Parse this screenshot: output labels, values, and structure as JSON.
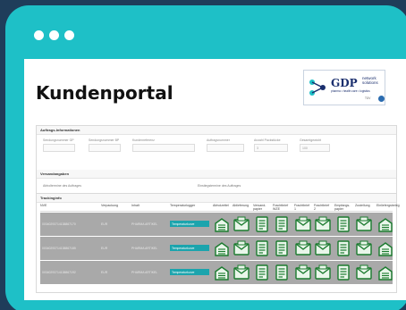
{
  "window": {
    "dots": 3
  },
  "page": {
    "title": "Kundenportal"
  },
  "logo": {
    "brand": "GDP",
    "tagline": "network solutions",
    "subline": "pharma • health care • logistics",
    "cert": "TÜV"
  },
  "order_info": {
    "title": "Auftrags-Informationen",
    "fields": [
      {
        "label": "Sendungsnummer GP",
        "value": ""
      },
      {
        "label": "Sendungsnummer BP",
        "value": ""
      },
      {
        "label": "Kundenreferenz",
        "value": ""
      },
      {
        "label": "Auftragsnummer",
        "value": ""
      },
      {
        "label": "Anzahl Packstücke",
        "value": "3"
      },
      {
        "label": "Gesamtgewicht",
        "value": "100"
      }
    ]
  },
  "shipping": {
    "title": "Versandangaben",
    "left_label": "Abholtermine des Auftrages",
    "right_label": "Einstiegstermine des Auftrages"
  },
  "tracking": {
    "title": "Trackinginfo",
    "columns": [
      "NVE",
      "Verpackung",
      "Inhalt",
      "Temperaturlogger",
      "Abholzettel",
      "Ablieferung",
      "Versand-papier",
      "Frachtbrief WZE",
      "Frachtbrief 1",
      "Frachtbrief 2",
      "Empfangs-papier",
      "Zustellung",
      "Einliefergsbeleg"
    ],
    "rows": [
      {
        "nve": "00340293714138867170",
        "pack": "EUR",
        "content": "PHARMA ARTIKEL",
        "logger": "Temperaturkurve"
      },
      {
        "nve": "00340293714138867185",
        "pack": "EUR",
        "content": "PHARMA ARTIKEL",
        "logger": "Temperaturkurve"
      },
      {
        "nve": "00340293714138867192",
        "pack": "EUR",
        "content": "PHARMA ARTIKEL",
        "logger": "Temperaturkurve"
      }
    ]
  },
  "colors": {
    "frame": "#1ec0c7",
    "background": "#1f3d5a",
    "accent": "#1ba4ad",
    "doc_green": "#1a7a2e"
  }
}
